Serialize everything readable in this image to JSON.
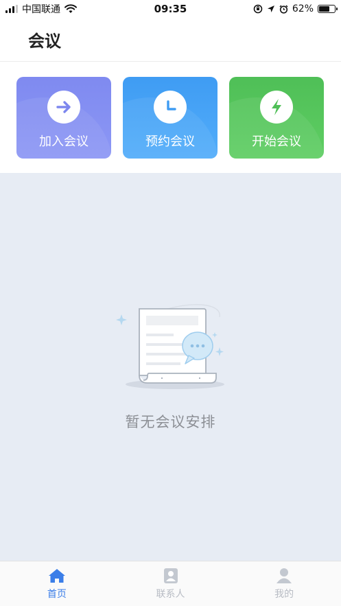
{
  "status_bar": {
    "carrier": "中国联通",
    "time": "09:35",
    "battery_text": "62%",
    "battery_level": 0.62
  },
  "header": {
    "title": "会议"
  },
  "actions": [
    {
      "label": "加入会议",
      "icon": "arrow-right-icon",
      "color": "#8591f3"
    },
    {
      "label": "预约会议",
      "icon": "clock-icon",
      "color": "#47a3f6"
    },
    {
      "label": "开始会议",
      "icon": "lightning-icon",
      "color": "#56c65c"
    }
  ],
  "empty_state": {
    "message": "暂无会议安排",
    "icon": "document-chat-illustration"
  },
  "tabbar": {
    "active_color": "#3b7ee8",
    "inactive_color": "#b8bcc4",
    "tabs": [
      {
        "label": "首页",
        "icon": "home-icon",
        "active": true
      },
      {
        "label": "联系人",
        "icon": "contacts-icon",
        "active": false
      },
      {
        "label": "我的",
        "icon": "profile-icon",
        "active": false
      }
    ]
  }
}
